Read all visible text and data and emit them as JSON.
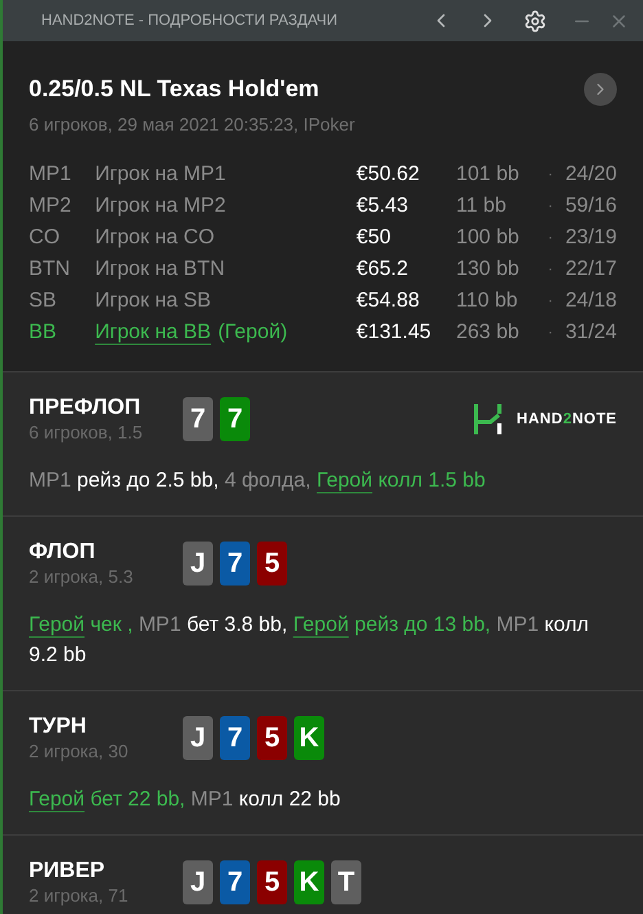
{
  "window": {
    "title": "HAND2NOTE - ПОДРОБНОСТИ РАЗДАЧИ"
  },
  "hand": {
    "title": "0.25/0.5 NL Texas Hold'em",
    "subtitle": "6 игроков, 29 мая 2021 20:35:23, IPoker"
  },
  "players": [
    {
      "position": "MP1",
      "name": "Игрок на MP1",
      "hero": false,
      "stack": "€50.62",
      "bb": "101 bb",
      "stats": "24/20"
    },
    {
      "position": "MP2",
      "name": "Игрок на MP2",
      "hero": false,
      "stack": "€5.43",
      "bb": "11 bb",
      "stats": "59/16"
    },
    {
      "position": "CO",
      "name": "Игрок на CO",
      "hero": false,
      "stack": "€50",
      "bb": "100 bb",
      "stats": "23/19"
    },
    {
      "position": "BTN",
      "name": "Игрок на BTN",
      "hero": false,
      "stack": "€65.2",
      "bb": "130 bb",
      "stats": "22/17"
    },
    {
      "position": "SB",
      "name": "Игрок на SB",
      "hero": false,
      "stack": "€54.88",
      "bb": "110 bb",
      "stats": "24/18"
    },
    {
      "position": "BB",
      "name": "Игрок на BB",
      "hero": true,
      "hero_tag": "(Герой)",
      "stack": "€131.45",
      "bb": "263 bb",
      "stats": "31/24"
    }
  ],
  "separator": "·",
  "logo": {
    "before": "HAND",
    "accent": "2",
    "after": "NOTE"
  },
  "streets": [
    {
      "name": "ПРЕФЛОП",
      "info": "6 игроков, 1.5",
      "logo": true,
      "cards": [
        {
          "rank": "7",
          "color": "#5f5f5f"
        },
        {
          "rank": "7",
          "color": "#0a8a0a"
        }
      ],
      "actions": [
        {
          "kind": "actor",
          "text": "MP1"
        },
        {
          "kind": "move",
          "text": "рейз до 2.5 bb,"
        },
        {
          "kind": "note",
          "text": "4 фолда,"
        },
        {
          "kind": "hero",
          "text": "Герой"
        },
        {
          "kind": "hero_move",
          "text": "колл 1.5 bb"
        }
      ]
    },
    {
      "name": "ФЛОП",
      "info": "2 игрока, 5.3",
      "logo": false,
      "cards": [
        {
          "rank": "J",
          "color": "#5f5f5f"
        },
        {
          "rank": "7",
          "color": "#0b5aa5"
        },
        {
          "rank": "5",
          "color": "#8b0000"
        }
      ],
      "actions": [
        {
          "kind": "hero",
          "text": "Герой"
        },
        {
          "kind": "hero_move",
          "text": "чек ,"
        },
        {
          "kind": "actor",
          "text": "MP1"
        },
        {
          "kind": "move",
          "text": "бет 3.8 bb,"
        },
        {
          "kind": "hero",
          "text": "Герой"
        },
        {
          "kind": "hero_move",
          "text": "рейз до 13 bb,"
        },
        {
          "kind": "actor",
          "text": "MP1"
        },
        {
          "kind": "move",
          "text": "колл 9.2 bb"
        }
      ]
    },
    {
      "name": "ТУРН",
      "info": "2 игрока, 30",
      "logo": false,
      "cards": [
        {
          "rank": "J",
          "color": "#5f5f5f"
        },
        {
          "rank": "7",
          "color": "#0b5aa5"
        },
        {
          "rank": "5",
          "color": "#8b0000"
        },
        {
          "rank": "K",
          "color": "#0a8a0a"
        }
      ],
      "actions": [
        {
          "kind": "hero",
          "text": "Герой"
        },
        {
          "kind": "hero_move",
          "text": "бет 22 bb,"
        },
        {
          "kind": "actor",
          "text": "MP1"
        },
        {
          "kind": "move",
          "text": "колл 22 bb"
        }
      ]
    },
    {
      "name": "РИВЕР",
      "info": "2 игрока, 71",
      "logo": false,
      "cards": [
        {
          "rank": "J",
          "color": "#5f5f5f"
        },
        {
          "rank": "7",
          "color": "#0b5aa5"
        },
        {
          "rank": "5",
          "color": "#8b0000"
        },
        {
          "rank": "K",
          "color": "#0a8a0a"
        },
        {
          "rank": "T",
          "color": "#5f5f5f"
        }
      ]
    }
  ]
}
